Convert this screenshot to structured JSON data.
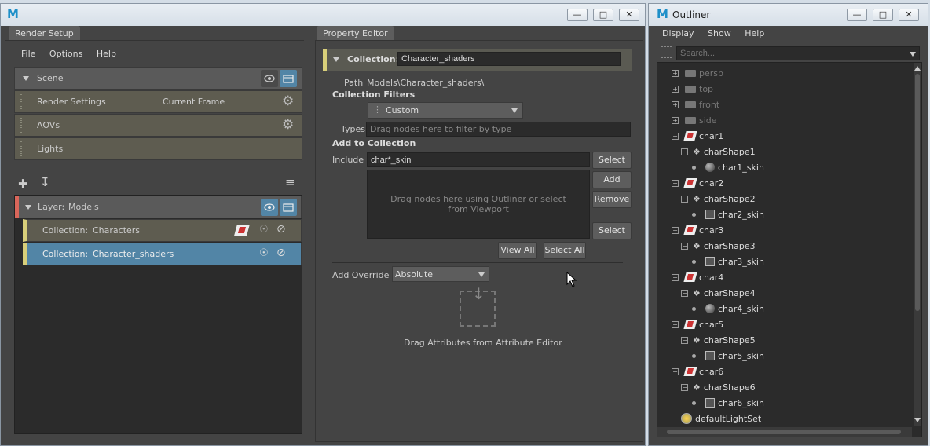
{
  "render_setup": {
    "tab": "Render Setup",
    "menu": [
      "File",
      "Options",
      "Help"
    ],
    "scene": {
      "label": "Scene"
    },
    "render_settings": {
      "label": "Render Settings",
      "value": "Current Frame"
    },
    "aovs": {
      "label": "AOVs"
    },
    "lights": {
      "label": "Lights"
    },
    "layer": {
      "prefix": "Layer:",
      "name": "Models"
    },
    "collections": [
      {
        "prefix": "Collection:",
        "name": "Characters"
      },
      {
        "prefix": "Collection:",
        "name": "Character_shaders"
      }
    ]
  },
  "property_editor": {
    "tab": "Property Editor",
    "collection_label": "Collection:",
    "collection_name": "Character_shaders",
    "path_label": "Path",
    "path_value": "Models\\Character_shaders\\",
    "filters_heading": "Collection Filters",
    "filter_value": "Custom",
    "types_label": "Types",
    "types_placeholder": "Drag nodes here to filter by type",
    "add_heading": "Add to Collection",
    "include_label": "Include",
    "include_value": "char*_skin",
    "drop_hint": "Drag nodes here using Outliner or select from Viewport",
    "buttons": {
      "select": "Select",
      "add": "Add",
      "remove": "Remove",
      "select2": "Select",
      "view_all": "View All",
      "select_all": "Select All"
    },
    "override_label": "Add Override",
    "override_value": "Absolute",
    "drag_attr": "Drag Attributes from Attribute Editor"
  },
  "outliner": {
    "title": "Outliner",
    "menu": [
      "Display",
      "Show",
      "Help"
    ],
    "search_placeholder": "Search...",
    "cameras": [
      "persp",
      "top",
      "front",
      "side"
    ],
    "chars": [
      {
        "name": "char1",
        "shape": "charShape1",
        "skin": "char1_skin",
        "skin_icon": "sphere"
      },
      {
        "name": "char2",
        "shape": "charShape2",
        "skin": "char2_skin",
        "skin_icon": "cube"
      },
      {
        "name": "char3",
        "shape": "charShape3",
        "skin": "char3_skin",
        "skin_icon": "cube"
      },
      {
        "name": "char4",
        "shape": "charShape4",
        "skin": "char4_skin",
        "skin_icon": "sphere"
      },
      {
        "name": "char5",
        "shape": "charShape5",
        "skin": "char5_skin",
        "skin_icon": "cube"
      },
      {
        "name": "char6",
        "shape": "charShape6",
        "skin": "char6_skin",
        "skin_icon": "cube"
      }
    ],
    "light_set": "defaultLightSet"
  }
}
